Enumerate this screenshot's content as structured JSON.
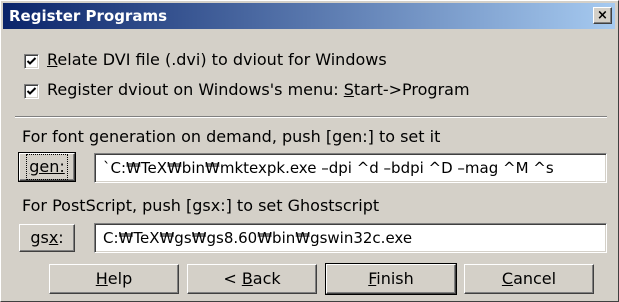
{
  "window": {
    "title": "Register Programs",
    "close_glyph": "×"
  },
  "options": [
    {
      "checked": true,
      "mnemonic": "R",
      "label_rest": "elate DVI file (.dvi) to dviout for Windows"
    },
    {
      "checked": true,
      "label_prefix": "Register dviout on Windows's menu: ",
      "mnemonic": "S",
      "label_rest": "tart->Program"
    }
  ],
  "gen": {
    "description": "For font generation on demand, push [gen:] to set it",
    "button_label": "gen:",
    "value": "`C:₩TeX₩bin₩mktexpk.exe –dpi ^d –bdpi ^D –mag ^M ^s"
  },
  "gsx": {
    "description": "For PostScript, push [gsx:] to set Ghostscript",
    "button_prefix": "gs",
    "button_mnemonic": "x",
    "button_suffix": ":",
    "value": "C:₩TeX₩gs₩gs8.60₩bin₩gswin32c.exe"
  },
  "buttons": {
    "help": {
      "mnemonic": "H",
      "rest": "elp"
    },
    "back": {
      "prefix": "< ",
      "mnemonic": "B",
      "rest": "ack"
    },
    "finish": {
      "mnemonic": "F",
      "rest": "inish"
    },
    "cancel": {
      "mnemonic": "C",
      "rest": "ancel"
    }
  }
}
